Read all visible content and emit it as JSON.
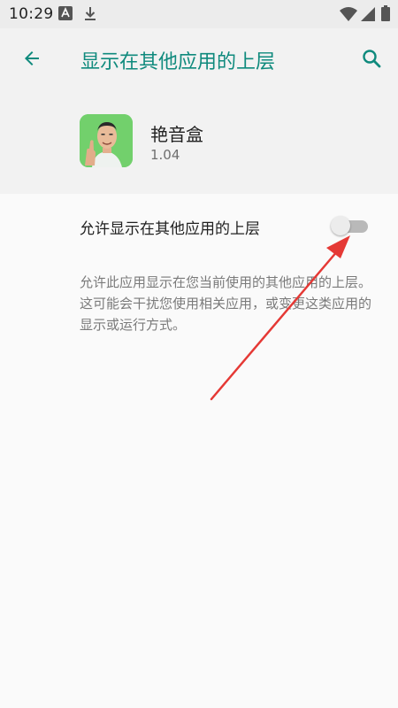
{
  "status_bar": {
    "time": "10:29",
    "icons": [
      "a-notification-icon",
      "download-icon",
      "wifi-icon",
      "signal-icon",
      "battery-icon"
    ]
  },
  "toolbar": {
    "title": "显示在其他应用的上层",
    "back_icon": "arrow-back-icon",
    "search_icon": "search-icon"
  },
  "app": {
    "name": "艳音盒",
    "version": "1.04",
    "icon": "app-icon-thumbs-up-person"
  },
  "setting": {
    "label": "允许显示在其他应用的上层",
    "enabled": false,
    "description": "允许此应用显示在您当前使用的其他应用的上层。这可能会干扰您使用相关应用，或变更这类应用的显示或运行方式。"
  },
  "colors": {
    "accent": "#0f8a7d",
    "annotation_arrow": "#e53935"
  }
}
